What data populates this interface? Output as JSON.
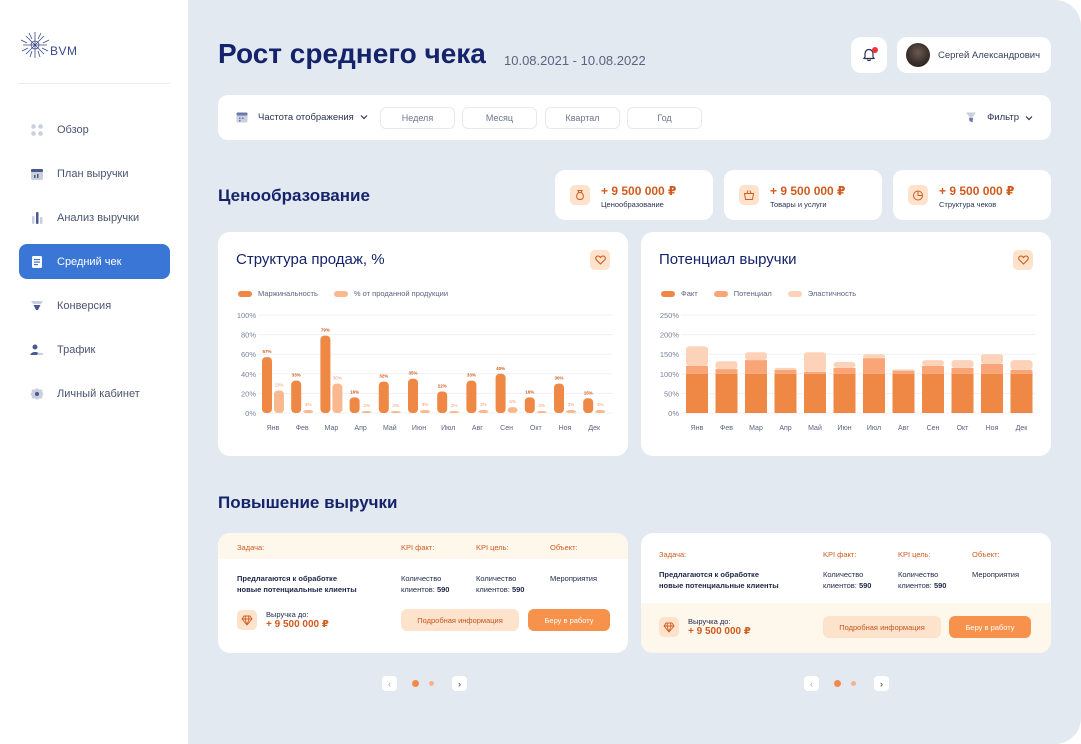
{
  "app": {
    "logo_text": "BVM"
  },
  "sidebar": {
    "items": [
      {
        "label": "Обзор",
        "icon": "dots-grid-icon",
        "active": false
      },
      {
        "label": "План выручки",
        "icon": "calendar-icon",
        "active": false
      },
      {
        "label": "Анализ выручки",
        "icon": "bar-chart-icon",
        "active": false
      },
      {
        "label": "Средний чек",
        "icon": "receipt-icon",
        "active": true
      },
      {
        "label": "Конверсия",
        "icon": "funnel-icon",
        "active": false
      },
      {
        "label": "Трафик",
        "icon": "users-icon",
        "active": false
      },
      {
        "label": "Личный кабинет",
        "icon": "gear-icon",
        "active": false
      }
    ]
  },
  "header": {
    "title": "Рост среднего чека",
    "date_range": "10.08.2021 - 10.08.2022",
    "user_name": "Сергей Александрович",
    "has_notification": true
  },
  "toolbar": {
    "frequency_label": "Частота отображения",
    "periods": [
      "Неделя",
      "Месяц",
      "Квартал",
      "Год"
    ],
    "filter_label": "Фильтр"
  },
  "pricing": {
    "title": "Ценообразование",
    "kpis": [
      {
        "value": "+ 9 500 000 ₽",
        "label": "Ценообразование",
        "icon": "money-bag-icon"
      },
      {
        "value": "+ 9 500 000 ₽",
        "label": "Товары и услуги",
        "icon": "basket-icon"
      },
      {
        "value": "+ 9 500 000 ₽",
        "label": "Структура чеков",
        "icon": "pie-icon"
      }
    ]
  },
  "colors": {
    "accent": "#3a76d6",
    "orange_dark": "#ef8745",
    "orange_mid": "#f9a577",
    "orange_light": "#fcd3b8",
    "navy": "#15236b"
  },
  "chart_data": [
    {
      "type": "bar",
      "title": "Структура продаж, %",
      "categories": [
        "Янв",
        "Фев",
        "Мар",
        "Апр",
        "Май",
        "Июн",
        "Июл",
        "Авг",
        "Сен",
        "Окт",
        "Ноя",
        "Дек"
      ],
      "series": [
        {
          "name": "Маржинальность",
          "values": [
            57,
            33,
            79,
            16,
            32,
            35,
            22,
            33,
            40,
            16,
            30,
            15
          ],
          "labels": [
            "57%",
            "33%",
            "79%",
            "16%",
            "32%",
            "35%",
            "22%",
            "33%",
            "40%",
            "16%",
            "30%",
            "15%"
          ]
        },
        {
          "name": "% от проданной продукции",
          "values": [
            23,
            3,
            30,
            2,
            2,
            3,
            2,
            3,
            6,
            2,
            3,
            3
          ],
          "labels": [
            "23%",
            "3%",
            "30%",
            "2%",
            "2%",
            "3%",
            "2%",
            "3%",
            "6%",
            "2%",
            "3%",
            "3%"
          ]
        }
      ],
      "yticks": [
        "100%",
        "80%",
        "60%",
        "40%",
        "20%",
        "0%"
      ],
      "ylim": [
        0,
        100
      ],
      "grid": true,
      "legend": "top-left"
    },
    {
      "type": "bar",
      "title": "Потенциал выручки",
      "categories": [
        "Янв",
        "Фев",
        "Мар",
        "Апр",
        "Май",
        "Июн",
        "Июл",
        "Авг",
        "Сен",
        "Окт",
        "Ноя",
        "Дек"
      ],
      "stacked": true,
      "series": [
        {
          "name": "Факт",
          "values": [
            100,
            100,
            100,
            100,
            100,
            100,
            100,
            100,
            100,
            100,
            100,
            100
          ]
        },
        {
          "name": "Потенциал",
          "values": [
            20,
            12,
            35,
            10,
            5,
            15,
            40,
            8,
            20,
            15,
            25,
            10
          ]
        },
        {
          "name": "Эластичность",
          "values": [
            50,
            20,
            20,
            5,
            50,
            15,
            10,
            3,
            15,
            20,
            25,
            25
          ]
        }
      ],
      "yticks": [
        "250%",
        "200%",
        "150%",
        "100%",
        "50%",
        "0%"
      ],
      "ylim": [
        0,
        250
      ],
      "grid": true,
      "legend": "top-left"
    }
  ],
  "revenue": {
    "title": "Повышение выручки",
    "cards": [
      {
        "task_header": "Задача:",
        "kpi_fact_header": "KPI факт:",
        "kpi_goal_header": "KPI цель:",
        "object_header": "Объект:",
        "task_line1": "Предлагаются к обработке",
        "task_line2": "новые потенциальные клиенты",
        "fact_line1": "Количество",
        "fact_line2": "клиентов:",
        "fact_value": "590",
        "goal_line1": "Количество",
        "goal_line2": "клиентов:",
        "goal_value": "590",
        "object_value": "Мероприятия",
        "revenue_label": "Выручка до:",
        "revenue_value": "+ 9 500 000 ₽",
        "detail_button": "Подробная информация",
        "work_button": "Беру в работу"
      },
      {
        "task_header": "Задача:",
        "kpi_fact_header": "KPI факт:",
        "kpi_goal_header": "KPI цель:",
        "object_header": "Объект:",
        "task_line1": "Предлагаются к обработке",
        "task_line2": "новые потенциальные клиенты",
        "fact_line1": "Количество",
        "fact_line2": "клиентов:",
        "fact_value": "590",
        "goal_line1": "Количество",
        "goal_line2": "клиентов:",
        "goal_value": "590",
        "object_value": "Мероприятия",
        "revenue_label": "Выручка до:",
        "revenue_value": "+ 9 500 000 ₽",
        "detail_button": "Подробная информация",
        "work_button": "Беру в работу"
      }
    ],
    "pager": {
      "prev": "‹",
      "next": "›"
    }
  }
}
